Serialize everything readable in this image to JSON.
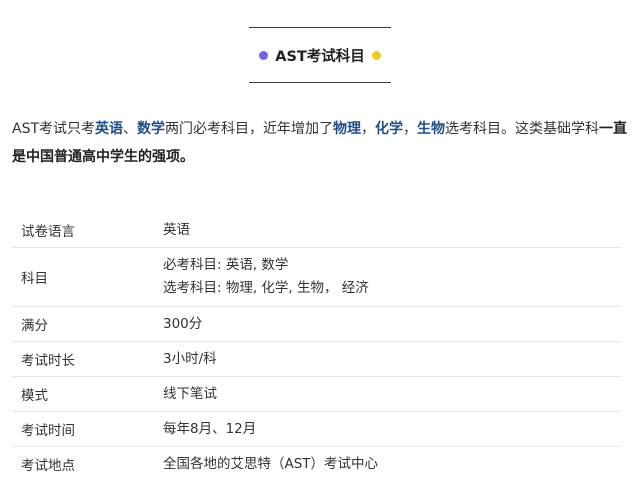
{
  "header": {
    "title": "AST考试科目",
    "dot_left_color": "#7b5ce6",
    "dot_right_color": "#f3c823"
  },
  "intro": {
    "p1": "AST考试只考",
    "s1": "英语",
    "p2": "、",
    "s2": "数学",
    "p3": "两门必考科目，近年增加了",
    "s3": "物理",
    "p4": "，",
    "s4": "化学",
    "p5": "，",
    "s5": "生物",
    "p6": "选考科目。这类基础学科",
    "s6": "一直是中国普通高中学生的强项。"
  },
  "table": {
    "rows": [
      {
        "label": "试卷语言",
        "values": [
          "英语"
        ]
      },
      {
        "label": "科目",
        "values": [
          "必考科目: 英语, 数学",
          "选考科目: 物理, 化学, 生物， 经济"
        ]
      },
      {
        "label": "满分",
        "values": [
          "300分"
        ]
      },
      {
        "label": "考试时长",
        "values": [
          "3小时/科"
        ]
      },
      {
        "label": "模式",
        "values": [
          "线下笔试"
        ]
      },
      {
        "label": "考试时间",
        "values": [
          "每年8月、12月"
        ]
      },
      {
        "label": "考试地点",
        "values": [
          "全国各地的艾思特（AST）考试中心"
        ]
      }
    ]
  }
}
